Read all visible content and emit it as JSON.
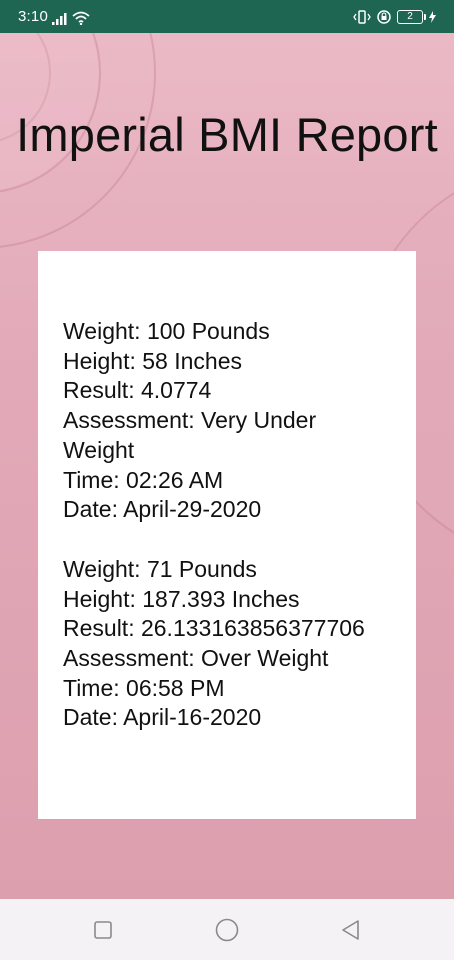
{
  "status_bar": {
    "time": "3:10",
    "battery_level": "2",
    "background_color": "#1e6651",
    "icons": [
      "signal-icon",
      "wifi-icon",
      "vibrate-icon",
      "screen-rotation-lock-icon",
      "battery-icon",
      "charging-icon"
    ]
  },
  "report": {
    "title": "Imperial BMI Report",
    "records": [
      {
        "weight": "Weight: 100 Pounds",
        "height": "Height: 58 Inches",
        "result": "Result: 4.0774",
        "assessment_line1": "Assessment: Very Under",
        "assessment_line2": "Weight",
        "time": "Time: 02:26 AM",
        "date": "Date: April-29-2020"
      },
      {
        "weight": "Weight: 71 Pounds",
        "height": "Height: 187.393 Inches",
        "result": "Result: 26.133163856377706",
        "assessment": "Assessment: Over Weight",
        "time": "Time: 06:58 PM",
        "date": "Date: April-16-2020"
      }
    ]
  },
  "theme": {
    "background_top": "#ebb9c6",
    "background_bottom": "#dc9fae",
    "card_color": "#ffffff",
    "text_color": "#111111"
  },
  "nav_bar": {
    "buttons": [
      "recent-apps-icon",
      "home-icon",
      "back-icon"
    ]
  }
}
